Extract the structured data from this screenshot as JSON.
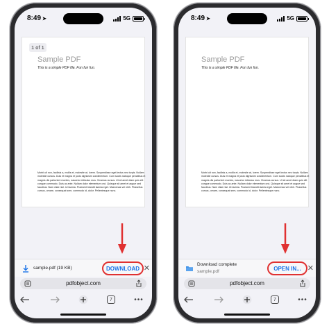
{
  "status": {
    "time": "8:49",
    "network": "5G"
  },
  "pdf": {
    "page_indicator": "1 of 1",
    "title": "Sample PDF",
    "subtitle": "This is a simple PDF file. Fun fun fun.",
    "body": "Morbi ult non, facilisis a, mollis et, molestie at, lorem. Suspendisse eget lectus nec turpis. Nullam molestie cursus. Duis et magna et justo dignissim condimentum. Cum sociis natoque penatibus et magnis dis parturient montes, nascetur ridiculus mus. Vivamus cursus. Ut sit amet diam quis elit congue commodo. Duis ac ante. Nullam dolor elementum orci. Quisque sit amet et augue sed faucibus. Nam vitae nisl. Ut lacinia. Praesent blandit lacinia eget. Maecenas vel nibh. Phasellus cursus, ornare, consequat sem, commodo id, dolor. Pellentesque nunc."
  },
  "left": {
    "download": {
      "filename": "sample.pdf (19 KB)",
      "button": "DOWNLOAD"
    }
  },
  "right": {
    "download": {
      "title": "Download complete",
      "filename": "sample.pdf",
      "button": "OPEN IN..."
    }
  },
  "url": "pdfobject.com",
  "tab_count": "7",
  "icons": {
    "download": "download-arrow-icon",
    "folder": "folder-icon",
    "close": "close-icon",
    "reader": "page-menu-icon",
    "share": "share-icon",
    "back": "back-arrow-icon",
    "forward": "forward-arrow-icon",
    "new_tab": "plus-icon",
    "tabs": "tabs-icon",
    "more": "more-icon"
  },
  "colors": {
    "accent": "#1a73e8",
    "annotation": "#e03131"
  }
}
